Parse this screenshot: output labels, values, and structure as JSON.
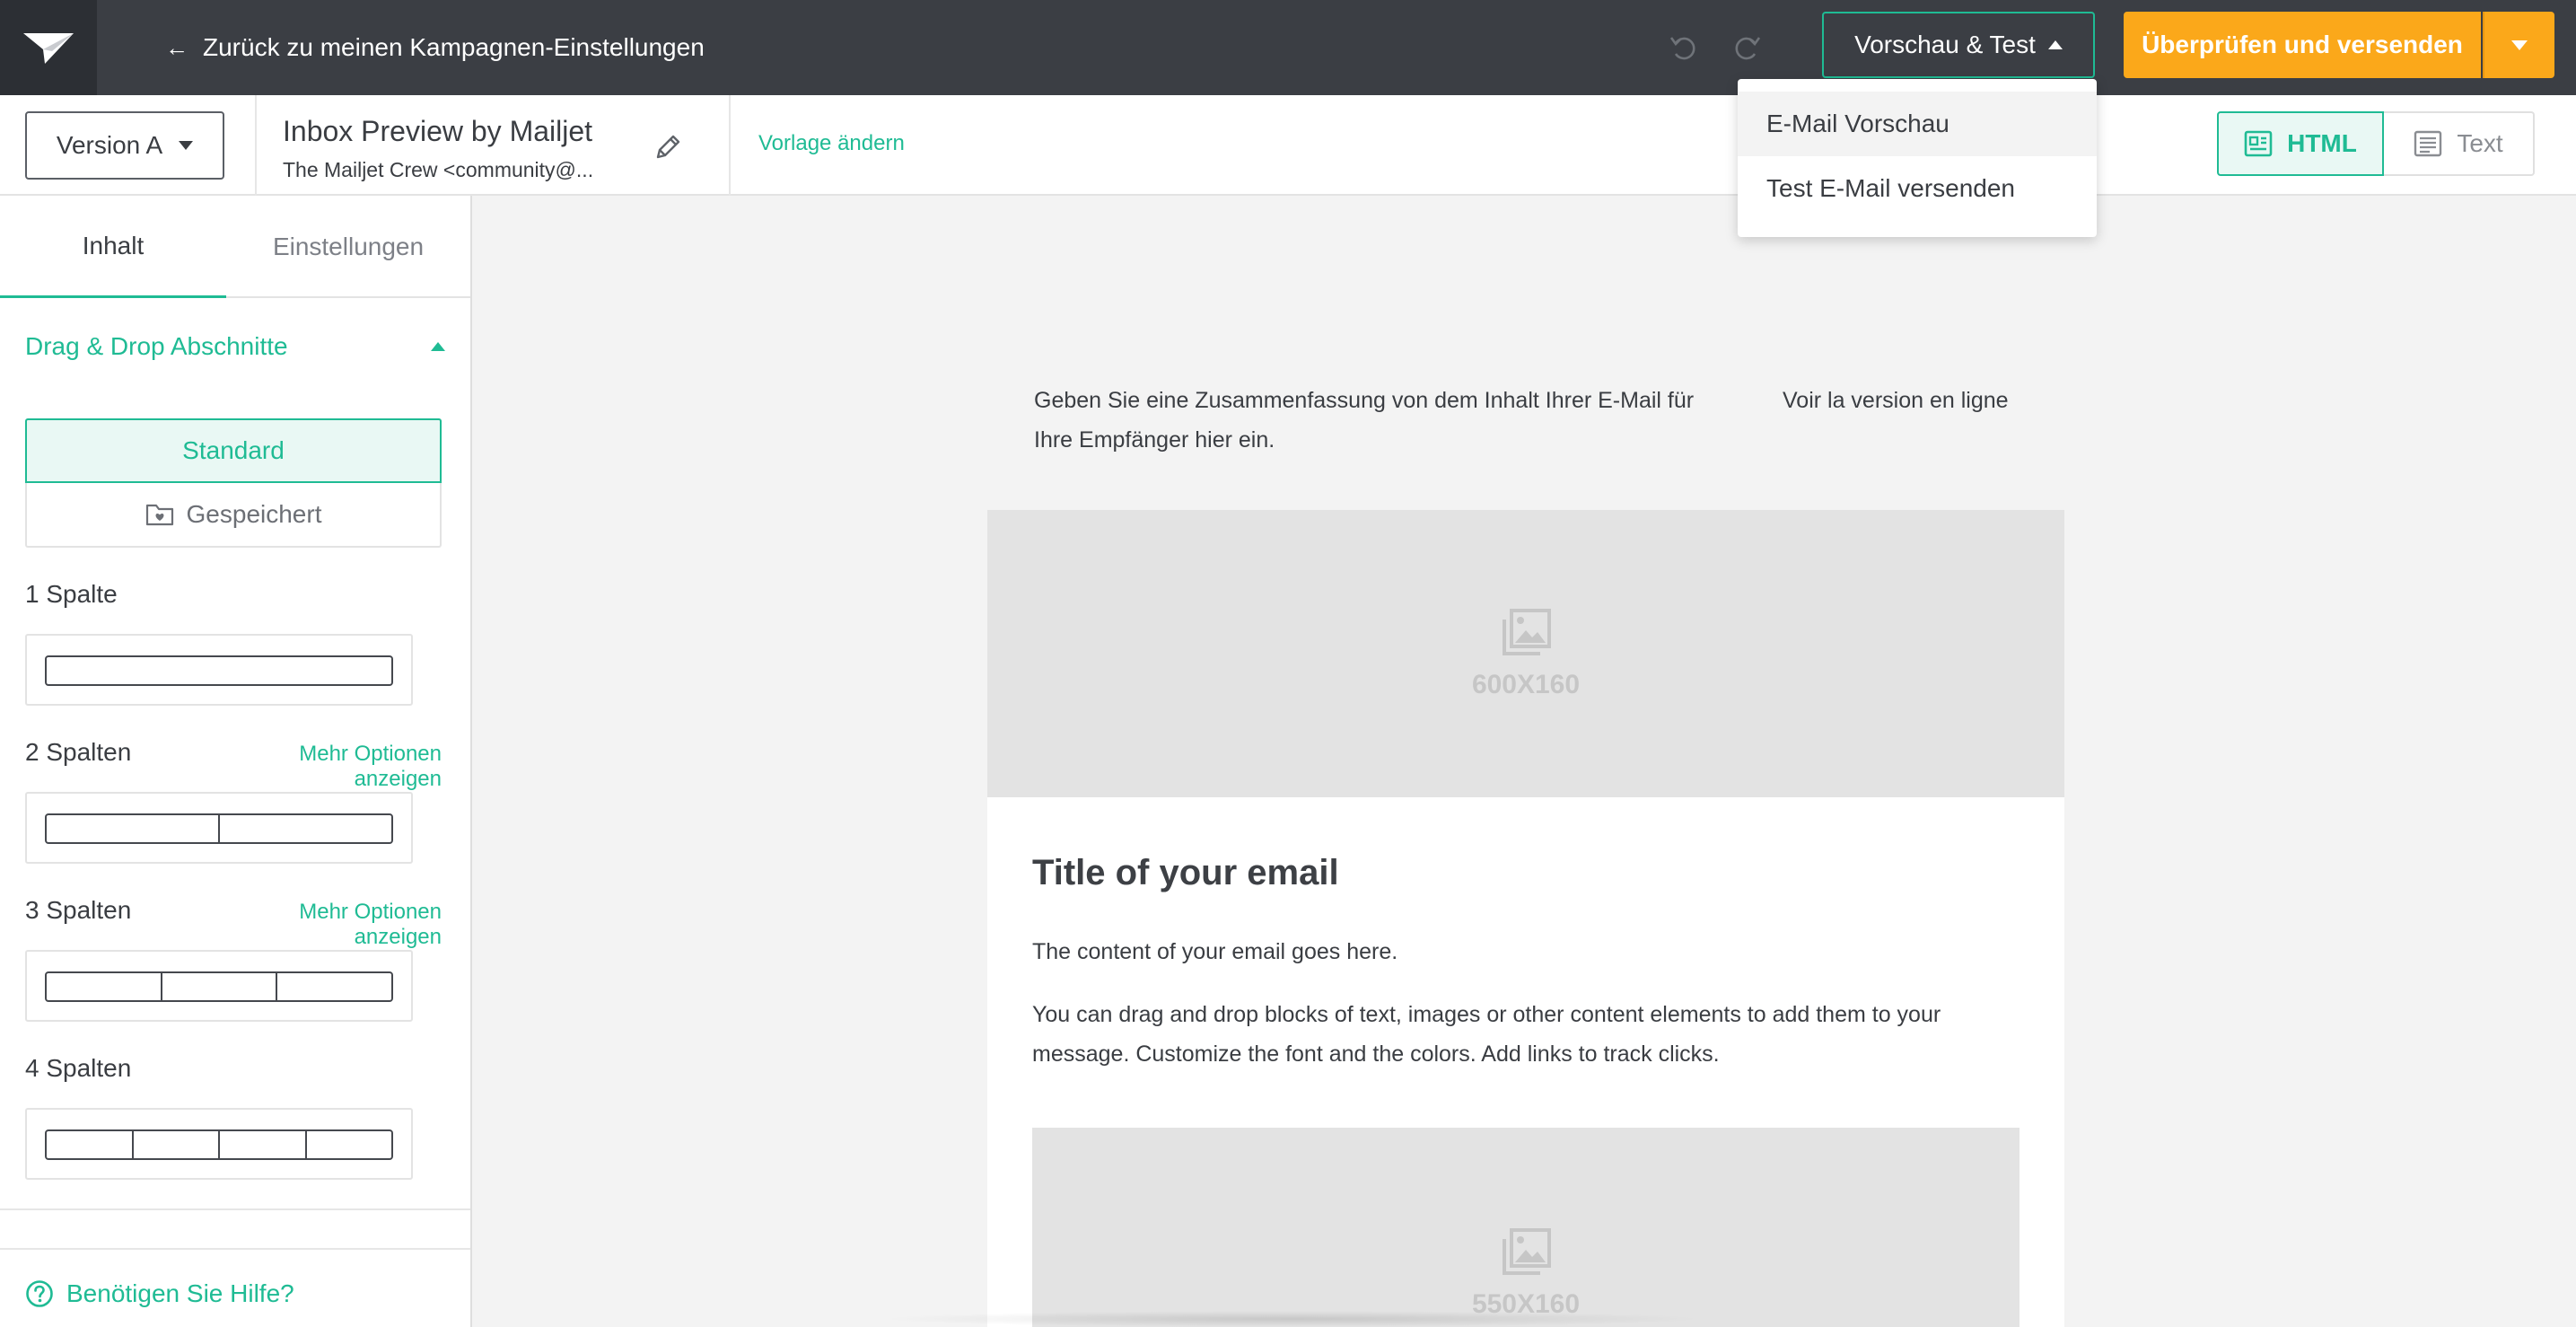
{
  "topbar": {
    "back_label": "Zurück zu meinen Kampagnen-Einstellungen",
    "preview_test_label": "Vorschau & Test",
    "review_send_label": "Überprüfen und versenden"
  },
  "preview_menu": {
    "items": [
      {
        "label": "E-Mail Vorschau"
      },
      {
        "label": "Test E-Mail versenden"
      }
    ]
  },
  "campaign": {
    "version_label": "Version A",
    "title": "Inbox Preview by Mailjet",
    "sender": "The Mailjet Crew <community@...",
    "change_template_label": "Vorlage ändern"
  },
  "view_toggle": {
    "html_label": "HTML",
    "text_label": "Text"
  },
  "sidebar": {
    "tabs": [
      {
        "label": "Inhalt",
        "active": true
      },
      {
        "label": "Einstellungen",
        "active": false
      }
    ],
    "section_title": "Drag & Drop Abschnitte",
    "standard_label": "Standard",
    "saved_label": "Gespeichert",
    "layouts": [
      {
        "label": "1 Spalte",
        "columns": 1,
        "more_options": ""
      },
      {
        "label": "2 Spalten",
        "columns": 2,
        "more_options": "Mehr Optionen anzeigen"
      },
      {
        "label": "3 Spalten",
        "columns": 3,
        "more_options": "Mehr Optionen anzeigen"
      },
      {
        "label": "4 Spalten",
        "columns": 4,
        "more_options": ""
      }
    ],
    "help_label": "Benötigen Sie Hilfe?"
  },
  "email": {
    "preheader": "Geben Sie eine Zusammenfassung von dem Inhalt Ihrer E-Mail für Ihre Empfänger hier ein.",
    "online_version": "Voir la version en ligne",
    "hero_placeholder": "600X160",
    "title": "Title of your email",
    "paragraph1": "The content of your email goes here.",
    "paragraph2": "You can drag and drop blocks of text, images or other content elements to add them to your message. Customize the font and the colors. Add links to track clicks.",
    "second_placeholder": "550X160"
  },
  "colors": {
    "accent": "#1fbb94",
    "send_button": "#fba81a",
    "topbar": "#3b3e44"
  }
}
